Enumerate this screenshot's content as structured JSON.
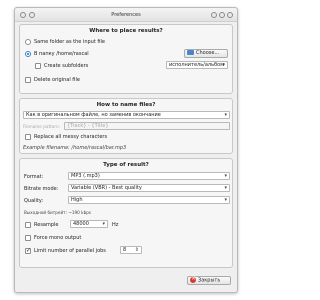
{
  "window": {
    "title": "Preferences"
  },
  "where": {
    "header": "Where to place results?",
    "same_folder_label": "Same folder as the input file",
    "in_folder_label": "В папку /home/rascal",
    "choose_label": "Choose...",
    "create_subfolders_label": "Create subfolders",
    "subfolder_pattern": "исполнитель/альбом",
    "delete_original_label": "Delete original file"
  },
  "name": {
    "header": "How to name files?",
    "naming_mode": "Как в оригинальном файле, но заменив окончание",
    "filename_pattern_label": "Filename pattern:",
    "filename_pattern_value": "{Track} - {Title}",
    "replace_messy_label": "Replace all messy characters",
    "example_label": "Example filename: /home/rascal/bar.mp3"
  },
  "type": {
    "header": "Type of result?",
    "format_label": "Format:",
    "format_value": "MP3 (.mp3)",
    "bitrate_label": "Bitrate mode:",
    "bitrate_value": "Variable (VBR) - Best quality",
    "quality_label": "Quality:",
    "quality_value": "High",
    "bitrate_note": "Выходной битрейт: ~190 kbps",
    "resample_label": "Resample",
    "resample_value": "48000",
    "resample_unit": "Hz",
    "mono_label": "Force mono output",
    "limit_label": "Limit number of parallel jobs",
    "limit_value": "8"
  },
  "footer": {
    "close_label": "Закрыть"
  }
}
